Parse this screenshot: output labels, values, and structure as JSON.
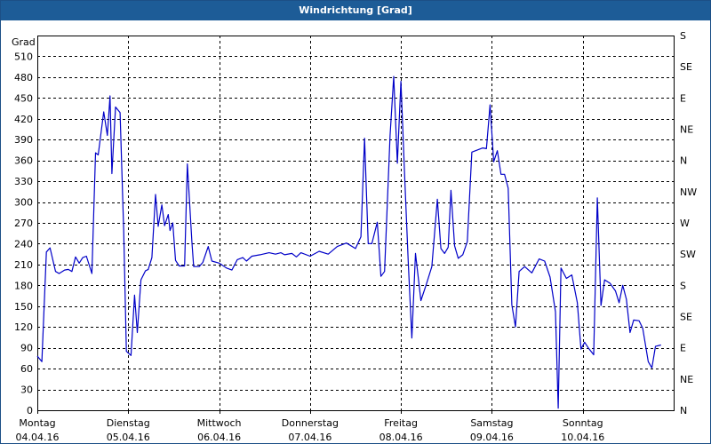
{
  "window": {
    "title": "Windrichtung [Grad]"
  },
  "colors": {
    "titlebar": "#1d5c97",
    "series": "#0000c8",
    "grid": "#000000"
  },
  "chart_data": {
    "type": "line",
    "title": "Windrichtung [Grad]",
    "ylabel": "Grad",
    "ylim": [
      0,
      540
    ],
    "yticks": [
      0,
      30,
      60,
      90,
      120,
      150,
      180,
      210,
      240,
      270,
      300,
      330,
      360,
      390,
      420,
      450,
      480,
      510
    ],
    "right_axis": {
      "values": [
        0,
        45,
        90,
        135,
        180,
        225,
        270,
        315,
        360,
        405,
        450,
        495,
        540
      ],
      "labels": [
        "N",
        "NE",
        "E",
        "SE",
        "S",
        "SW",
        "W",
        "NW",
        "N",
        "NE",
        "E",
        "SE",
        "S"
      ]
    },
    "xlim": [
      0,
      7
    ],
    "x_ticks": [
      {
        "day": "Montag",
        "date": "04.04.16"
      },
      {
        "day": "Dienstag",
        "date": "05.04.16"
      },
      {
        "day": "Mittwoch",
        "date": "06.04.16"
      },
      {
        "day": "Donnerstag",
        "date": "07.04.16"
      },
      {
        "day": "Freitag",
        "date": "08.04.16"
      },
      {
        "day": "Samstag",
        "date": "09.04.16"
      },
      {
        "day": "Sonntag",
        "date": "10.04.16"
      }
    ],
    "grid": true,
    "series": [
      {
        "points": [
          [
            0.0,
            78
          ],
          [
            0.05,
            70
          ],
          [
            0.1,
            228
          ],
          [
            0.14,
            234
          ],
          [
            0.2,
            200
          ],
          [
            0.24,
            197
          ],
          [
            0.3,
            202
          ],
          [
            0.34,
            203
          ],
          [
            0.38,
            200
          ],
          [
            0.42,
            221
          ],
          [
            0.46,
            212
          ],
          [
            0.5,
            220
          ],
          [
            0.54,
            222
          ],
          [
            0.6,
            197
          ],
          [
            0.64,
            371
          ],
          [
            0.67,
            368
          ],
          [
            0.73,
            430
          ],
          [
            0.77,
            396
          ],
          [
            0.8,
            453
          ],
          [
            0.82,
            341
          ],
          [
            0.86,
            437
          ],
          [
            0.91,
            429
          ],
          [
            0.95,
            258
          ],
          [
            0.98,
            85
          ],
          [
            1.03,
            79
          ],
          [
            1.07,
            166
          ],
          [
            1.1,
            112
          ],
          [
            1.14,
            188
          ],
          [
            1.19,
            201
          ],
          [
            1.22,
            203
          ],
          [
            1.26,
            220
          ],
          [
            1.3,
            311
          ],
          [
            1.33,
            265
          ],
          [
            1.37,
            296
          ],
          [
            1.4,
            266
          ],
          [
            1.44,
            282
          ],
          [
            1.46,
            259
          ],
          [
            1.49,
            270
          ],
          [
            1.52,
            216
          ],
          [
            1.56,
            208
          ],
          [
            1.62,
            208
          ],
          [
            1.65,
            355
          ],
          [
            1.7,
            243
          ],
          [
            1.72,
            207
          ],
          [
            1.78,
            207
          ],
          [
            1.82,
            213
          ],
          [
            1.88,
            236
          ],
          [
            1.92,
            215
          ],
          [
            2.0,
            212
          ],
          [
            2.08,
            205
          ],
          [
            2.14,
            202
          ],
          [
            2.2,
            217
          ],
          [
            2.26,
            220
          ],
          [
            2.3,
            215
          ],
          [
            2.36,
            222
          ],
          [
            2.45,
            224
          ],
          [
            2.55,
            227
          ],
          [
            2.62,
            225
          ],
          [
            2.68,
            227
          ],
          [
            2.72,
            224
          ],
          [
            2.8,
            226
          ],
          [
            2.85,
            221
          ],
          [
            2.9,
            227
          ],
          [
            3.0,
            222
          ],
          [
            3.1,
            229
          ],
          [
            3.2,
            225
          ],
          [
            3.3,
            236
          ],
          [
            3.4,
            241
          ],
          [
            3.5,
            233
          ],
          [
            3.56,
            250
          ],
          [
            3.6,
            392
          ],
          [
            3.64,
            240
          ],
          [
            3.68,
            240
          ],
          [
            3.74,
            271
          ],
          [
            3.78,
            193
          ],
          [
            3.82,
            200
          ],
          [
            3.88,
            396
          ],
          [
            3.92,
            481
          ],
          [
            3.96,
            356
          ],
          [
            4.0,
            474
          ],
          [
            4.04,
            341
          ],
          [
            4.08,
            215
          ],
          [
            4.12,
            104
          ],
          [
            4.16,
            226
          ],
          [
            4.22,
            158
          ],
          [
            4.28,
            182
          ],
          [
            4.34,
            207
          ],
          [
            4.4,
            304
          ],
          [
            4.44,
            233
          ],
          [
            4.48,
            226
          ],
          [
            4.52,
            235
          ],
          [
            4.55,
            317
          ],
          [
            4.59,
            237
          ],
          [
            4.63,
            219
          ],
          [
            4.68,
            224
          ],
          [
            4.73,
            243
          ],
          [
            4.78,
            372
          ],
          [
            4.84,
            375
          ],
          [
            4.9,
            378
          ],
          [
            4.94,
            377
          ],
          [
            4.98,
            440
          ],
          [
            5.02,
            358
          ],
          [
            5.06,
            374
          ],
          [
            5.1,
            340
          ],
          [
            5.14,
            340
          ],
          [
            5.18,
            320
          ],
          [
            5.22,
            152
          ],
          [
            5.26,
            120
          ],
          [
            5.3,
            200
          ],
          [
            5.36,
            207
          ],
          [
            5.44,
            198
          ],
          [
            5.52,
            218
          ],
          [
            5.58,
            215
          ],
          [
            5.64,
            192
          ],
          [
            5.7,
            142
          ],
          [
            5.73,
            3
          ],
          [
            5.76,
            205
          ],
          [
            5.82,
            190
          ],
          [
            5.88,
            195
          ],
          [
            5.94,
            155
          ],
          [
            5.98,
            88
          ],
          [
            6.02,
            98
          ],
          [
            6.06,
            90
          ],
          [
            6.12,
            80
          ],
          [
            6.16,
            306
          ],
          [
            6.2,
            151
          ],
          [
            6.24,
            188
          ],
          [
            6.3,
            183
          ],
          [
            6.36,
            172
          ],
          [
            6.4,
            155
          ],
          [
            6.44,
            180
          ],
          [
            6.48,
            160
          ],
          [
            6.52,
            112
          ],
          [
            6.56,
            130
          ],
          [
            6.62,
            129
          ],
          [
            6.66,
            118
          ],
          [
            6.72,
            70
          ],
          [
            6.76,
            61
          ],
          [
            6.8,
            92
          ],
          [
            6.86,
            94
          ]
        ]
      }
    ]
  }
}
